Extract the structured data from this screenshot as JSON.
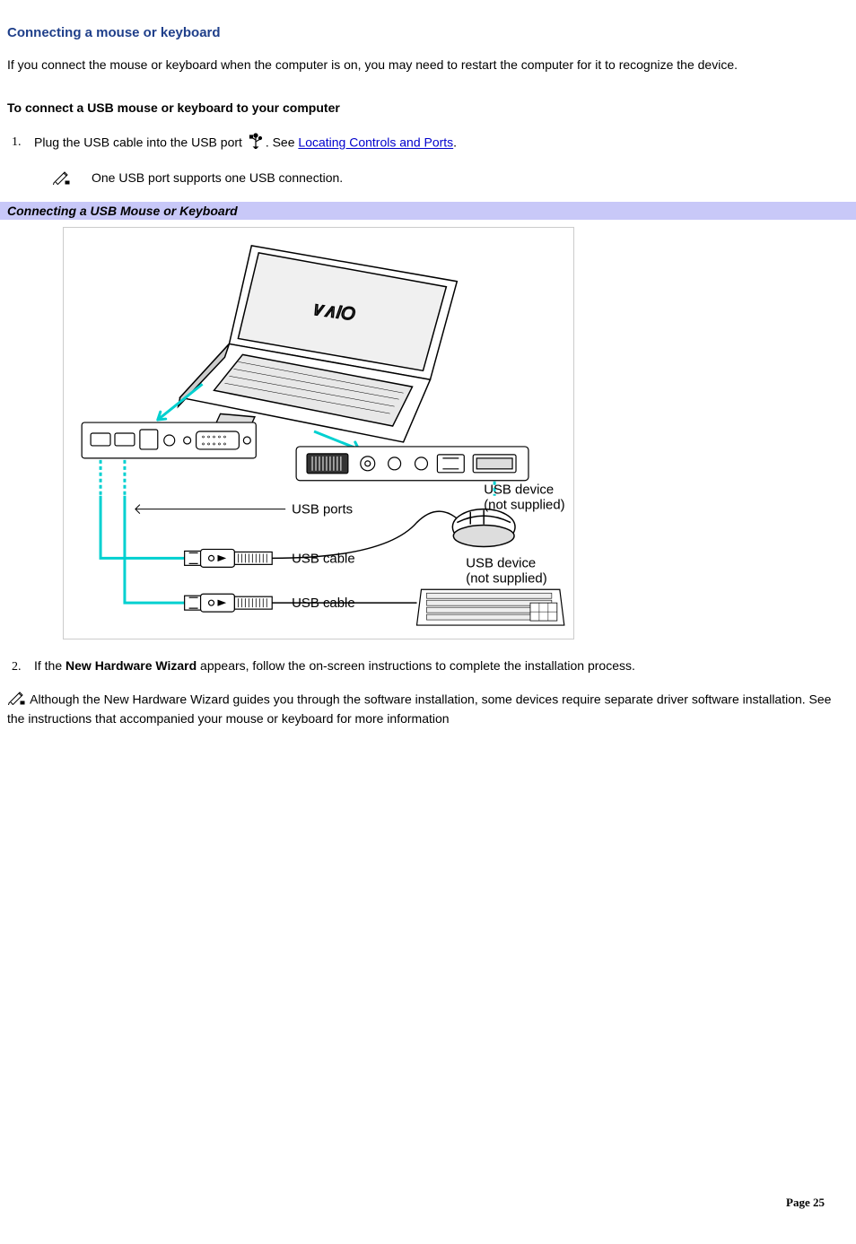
{
  "heading": "Connecting a mouse or keyboard",
  "intro": "If you connect the mouse or keyboard when the computer is on, you may need to restart the computer for it to recognize the device.",
  "subheading": "To connect a USB mouse or keyboard to your computer",
  "step1_a": "Plug the USB cable into the USB port ",
  "step1_b": ". See ",
  "step1_link": "Locating Controls and Ports",
  "step1_c": ".",
  "note1": "One USB port supports one USB connection.",
  "figure_caption": "Connecting a USB Mouse or Keyboard",
  "diagram": {
    "label_usb_ports": "USB ports",
    "label_usb_cable_1": "USB cable",
    "label_usb_cable_2": "USB cable",
    "label_device_1a": "USB device",
    "label_device_1b": "(not supplied)",
    "label_device_2a": "USB device",
    "label_device_2b": "(not supplied)"
  },
  "step2_a": "If the ",
  "step2_bold": "New Hardware Wizard",
  "step2_b": " appears, follow the on-screen instructions to complete the installation process.",
  "note2": " Although the New Hardware Wizard guides you through the software installation, some devices require separate driver software installation. See the instructions that accompanied your mouse or keyboard for more information",
  "page_number": "Page 25"
}
